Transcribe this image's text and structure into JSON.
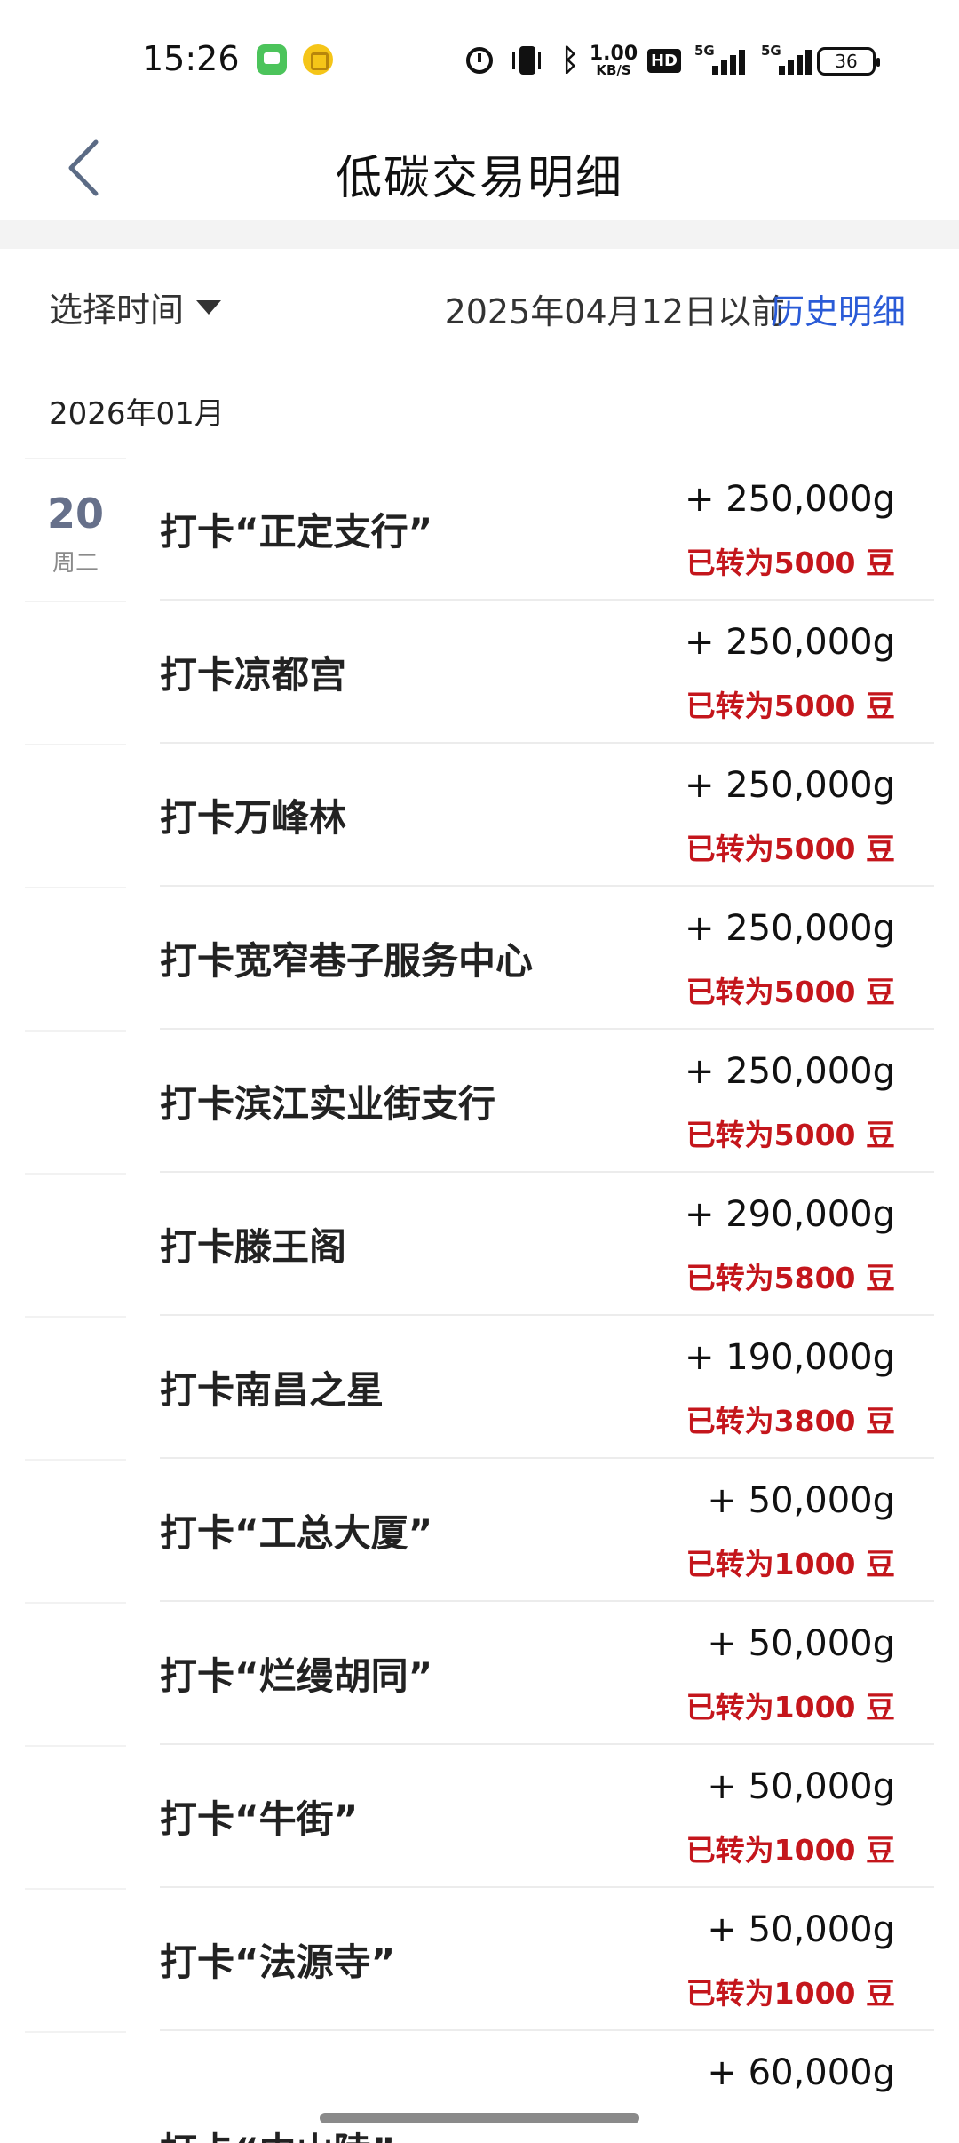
{
  "status_bar": {
    "time": "15:26",
    "net_speed_value": "1.00",
    "net_speed_unit": "KB/S",
    "hd_label": "HD",
    "signal1_label": "5G",
    "signal2_label": "5G",
    "battery": "36"
  },
  "header": {
    "title": "低碳交易明细"
  },
  "filter": {
    "time_select_label": "选择时间",
    "before_date_text": "2025年04月12日以前",
    "history_link": "历史明细"
  },
  "month_label": "2026年01月",
  "date_group": {
    "day": "20",
    "weekday": "周二"
  },
  "transactions": [
    {
      "title": "打卡“正定支行”",
      "amount": "+ 250,000g",
      "beans": "已转为5000 豆"
    },
    {
      "title": "打卡凉都宫",
      "amount": "+ 250,000g",
      "beans": "已转为5000 豆"
    },
    {
      "title": "打卡万峰林",
      "amount": "+ 250,000g",
      "beans": "已转为5000 豆"
    },
    {
      "title": "打卡宽窄巷子服务中心",
      "amount": "+ 250,000g",
      "beans": "已转为5000 豆"
    },
    {
      "title": "打卡滨江实业街支行",
      "amount": "+ 250,000g",
      "beans": "已转为5000 豆"
    },
    {
      "title": "打卡滕王阁",
      "amount": "+ 290,000g",
      "beans": "已转为5800 豆"
    },
    {
      "title": "打卡南昌之星",
      "amount": "+ 190,000g",
      "beans": "已转为3800 豆"
    },
    {
      "title": "打卡“工总大厦”",
      "amount": "+ 50,000g",
      "beans": "已转为1000 豆"
    },
    {
      "title": "打卡“烂缦胡同”",
      "amount": "+ 50,000g",
      "beans": "已转为1000 豆"
    },
    {
      "title": "打卡“牛街”",
      "amount": "+ 50,000g",
      "beans": "已转为1000 豆"
    },
    {
      "title": "打卡“法源寺”",
      "amount": "+ 50,000g",
      "beans": "已转为1000 豆"
    },
    {
      "title": "打卡“中山陵”",
      "amount": "+ 60,000g",
      "beans": ""
    }
  ],
  "colors": {
    "accent_link": "#2a5bd7",
    "beans_red": "#c4161c",
    "day_number": "#66708a"
  }
}
